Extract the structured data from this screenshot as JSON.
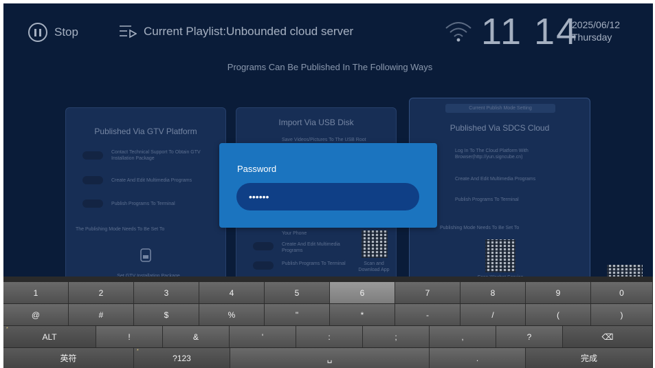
{
  "status_bar": {
    "stop_label": "Stop",
    "playlist_label": "Current Playlist:Unbounded cloud server",
    "time": "11 14",
    "date": "2025/06/12",
    "weekday": "Thursday"
  },
  "background": {
    "programs_title": "Programs Can Be Published In The Following Ways",
    "cards": [
      {
        "title": "Published Via GTV Platform",
        "lines": [
          "Contact Technical Support To Obtain GTV Installation Package",
          "Create And Edit Multimedia Programs",
          "Publish Programs To Terminal"
        ],
        "footer": "The Publishing Mode Needs To Be Set To",
        "caption": "Set GTV Installation Package"
      },
      {
        "title": "Import Via USB Disk",
        "lines": [
          "Save Videos/Pictures To The USB Root",
          "Your Phone",
          "Create And Edit Multimedia Programs",
          "Publish Programs To Terminal"
        ],
        "caption": "Scan and Download App"
      },
      {
        "header": "Current Publish Mode Setting",
        "title": "Published Via SDCS Cloud",
        "lines": [
          "Log In To The Cloud Platform With Browser(http://yun.signcube.cn)",
          "Create And Edit Multimedia Programs",
          "Publish Programs To Terminal"
        ],
        "footer": "Publishing Mode Needs To Be Set To",
        "caption": "Scan Wechat Service"
      }
    ]
  },
  "dialog": {
    "title": "Password",
    "value": "••••••"
  },
  "keyboard": {
    "rows": [
      [
        "1",
        "2",
        "3",
        "4",
        "5",
        "6",
        "7",
        "8",
        "9",
        "0"
      ],
      [
        "@",
        "#",
        "$",
        "%",
        "\"",
        "*",
        "-",
        "/",
        "(",
        ")"
      ],
      [
        "ALT",
        "!",
        "&",
        "'",
        ":",
        ";",
        ",",
        "?",
        "⌫"
      ],
      [
        "英符",
        "?123",
        "␣",
        ".",
        "完成"
      ]
    ],
    "highlighted_key": "6"
  },
  "colors": {
    "background": "#0b1f3f",
    "dialog": "#1b74bf",
    "input": "#0f3f86",
    "key": "#5c5c5c"
  }
}
